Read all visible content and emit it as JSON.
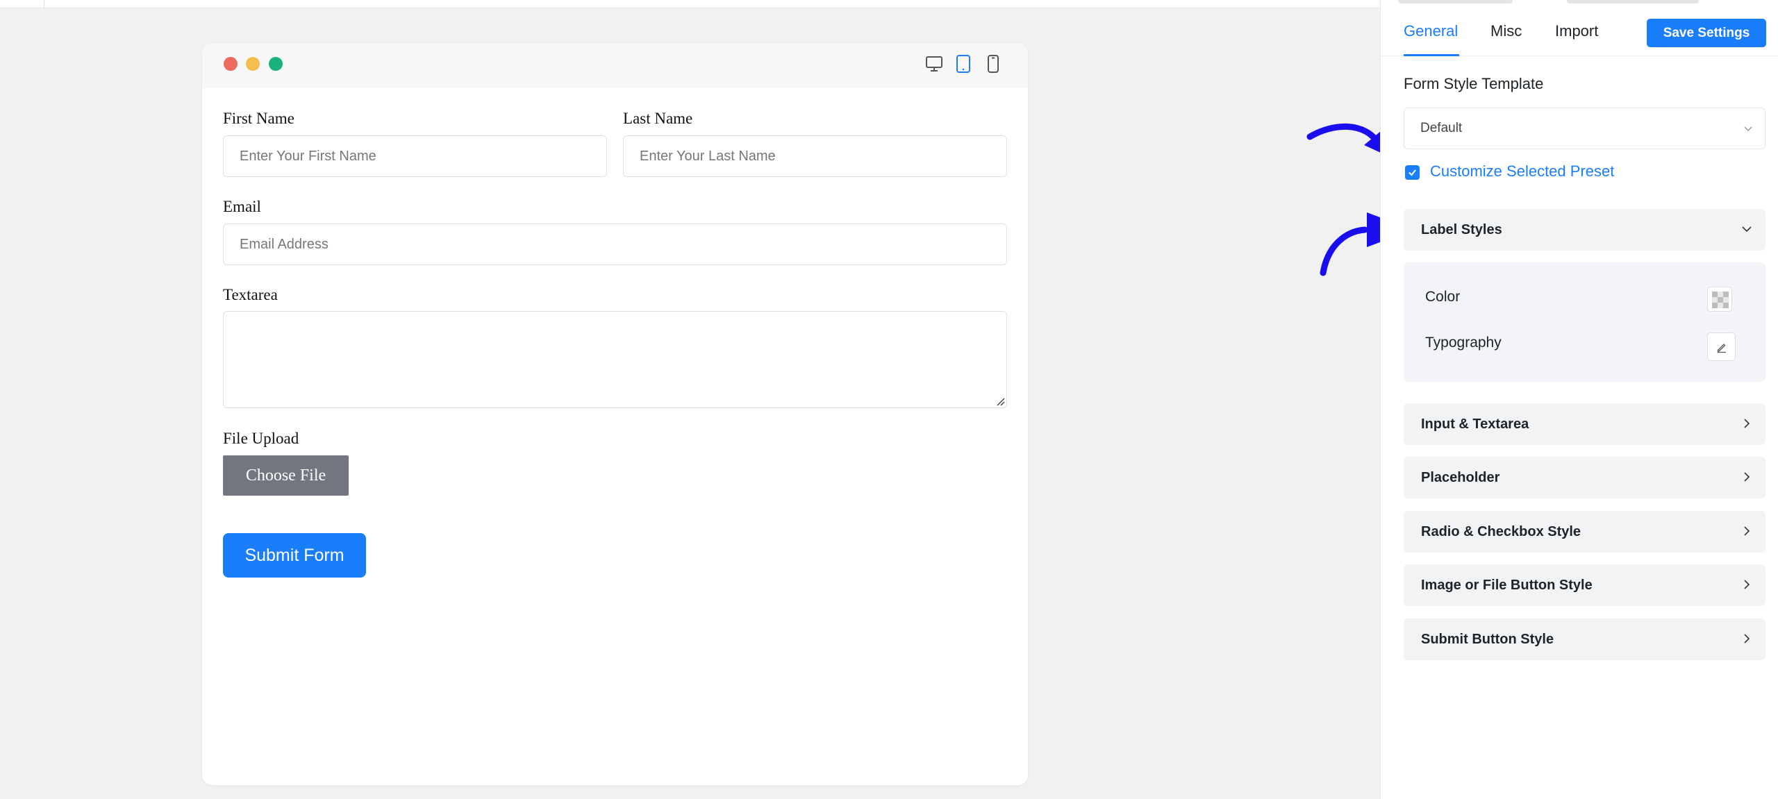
{
  "preview": {
    "device_icons": [
      "desktop-icon",
      "tablet-icon",
      "mobile-icon"
    ],
    "active_device": "tablet",
    "form": {
      "first_name_label": "First Name",
      "first_name_placeholder": "Enter Your First Name",
      "last_name_label": "Last Name",
      "last_name_placeholder": "Enter Your Last Name",
      "email_label": "Email",
      "email_placeholder": "Email Address",
      "textarea_label": "Textarea",
      "file_label": "File Upload",
      "choose_file": "Choose File",
      "submit": "Submit Form"
    }
  },
  "panel": {
    "tabs": [
      {
        "label": "General",
        "active": true
      },
      {
        "label": "Misc",
        "active": false
      },
      {
        "label": "Import",
        "active": false
      }
    ],
    "save_button": "Save Settings",
    "template_title": "Form Style Template",
    "template_value": "Default",
    "customize_label": "Customize Selected Preset",
    "customize_checked": true,
    "label_styles": {
      "title": "Label Styles",
      "expanded": true,
      "color_label": "Color",
      "typography_label": "Typography"
    },
    "sections": [
      {
        "label": "Input & Textarea"
      },
      {
        "label": "Placeholder"
      },
      {
        "label": "Radio & Checkbox Style"
      },
      {
        "label": "Image or File Button Style"
      },
      {
        "label": "Submit Button Style"
      }
    ]
  },
  "colors": {
    "accent": "#1a7efb",
    "annotation_arrow": "#1a0ef0",
    "file_button": "#72777f"
  }
}
